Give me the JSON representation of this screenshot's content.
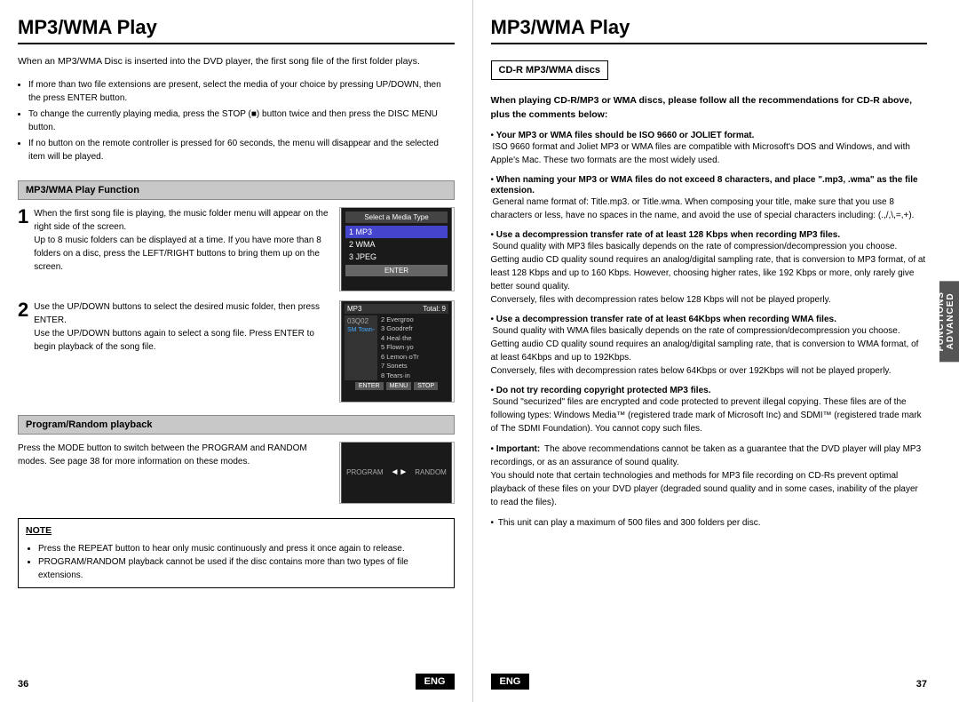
{
  "left": {
    "title": "MP3/WMA Play",
    "intro": "When an MP3/WMA Disc is inserted into the DVD player, the first song file of the first folder plays.",
    "bullets": [
      "If more than two file extensions are present, select the media of your choice by pressing UP/DOWN, then the press ENTER button.",
      "To change the currently playing media, press the STOP (■) button twice and then press the DISC MENU button.",
      "If no button on the remote controller is pressed for 60 seconds, the menu will disappear and the selected item will be played."
    ],
    "section1_header": "MP3/WMA Play Function",
    "step1_number": "1",
    "step1_text": "When the first song file is playing, the music folder menu will appear on the right side of the screen.\nUp to 8 music folders can be displayed at a time. If you have more than 8 folders on a disc, press the LEFT/RIGHT buttons to bring them up on the screen.",
    "step2_number": "2",
    "step2_text": "Use the UP/DOWN buttons to select the desired music folder, then press ENTER.\nUse the UP/DOWN buttons again to select a song file. Press ENTER to begin playback of the song file.",
    "section2_header": "Program/Random playback",
    "section2_text": "Press the MODE button to switch between the PROGRAM and RANDOM modes. See page 38 for more information on these modes.",
    "note_header": "NOTE",
    "note_bullets": [
      "Press the REPEAT button to hear only music continuously and press it once again to release.",
      "PROGRAM/RANDOM playback cannot be used if the disc contains more than two types of file extensions."
    ],
    "page_number": "36",
    "eng_label": "ENG",
    "media_selector": {
      "title": "Select a Media Type",
      "items": [
        "1 MP3",
        "2 WMA",
        "3 JPEG"
      ],
      "selected": 0,
      "enter": "ENTER"
    },
    "folder_list": {
      "label": "MP3",
      "total": "Total: 9",
      "folder": "03Q02",
      "items": [
        "2 Evergroo",
        "3 Goodrefr",
        "4 Heal-the",
        "5 Flown-yo",
        "6 Lemon-oTr",
        "7 Sonets",
        "8 Tears-in"
      ],
      "selected_folder": "SM Town-"
    },
    "program_random": {
      "program": "PROGRAM",
      "arrow": "◄►",
      "random": "RANDOM"
    }
  },
  "right": {
    "title": "MP3/WMA Play",
    "cdr_header": "CD-R MP3/WMA discs",
    "bold_intro": "When playing CD-R/MP3 or WMA discs, please follow all the recommendations for CD-R above, plus the comments below:",
    "bullets": [
      {
        "title": "Your MP3 or WMA files should be ISO 9660 or JOLIET format.",
        "text": "ISO 9660 format and Joliet MP3 or WMA files are compatible with Microsoft's DOS and Windows, and with Apple's Mac. These two formats are the most widely used."
      },
      {
        "title": "When naming your MP3 or WMA files do not exceed 8 characters, and place \".mp3, .wma\" as the file extension.",
        "text": "General name format of: Title.mp3. or Title.wma. When composing your title, make sure that you use 8 characters or less, have no spaces in the name, and avoid the use of special characters including: (.,/,\\,=,+)."
      },
      {
        "title": "Use a decompression transfer rate of at least 128 Kbps when recording MP3 files.",
        "text": "Sound quality with MP3 files basically depends on the rate of compression/decompression you choose. Getting audio CD quality sound requires an analog/digital sampling rate, that is conversion to MP3 format, of at least 128 Kbps and up to 160 Kbps. However, choosing higher rates, like 192 Kbps or more, only rarely give better sound quality.\nConversely, files with decompression rates below 128 Kbps will not be played properly."
      },
      {
        "title": "Use a decompression transfer rate of at least 64Kbps when recording WMA files.",
        "text": "Sound quality with WMA files basically depends on the rate of compression/decompression you choose. Getting audio CD quality sound requires an analog/digital sampling rate, that is conversion to WMA format, of at least 64Kbps and up to 192Kbps.\nConversely, files with decompression rates below 64Kbps or over 192Kbps will not be played properly."
      },
      {
        "title": "Do not try recording copyright protected MP3 files.",
        "text": "Sound \"securized\" files are encrypted and code protected to prevent illegal copying. These files are of the following types: Windows Media™ (registered trade mark of Microsoft Inc) and SDMI™ (registered trade mark of The SDMI Foundation). You cannot copy such files."
      },
      {
        "title": "Important:",
        "text": "The above recommendations cannot be taken as a guarantee that the DVD player will play MP3 recordings, or as an assurance of sound quality.\nYou should note that certain technologies and methods for MP3 file recording on CD-Rs prevent optimal playback of these files on your DVD player (degraded sound quality and in some cases, inability of the player to read the files)."
      },
      {
        "title": "",
        "text": "This unit can play a maximum of 500 files and 300 folders per disc."
      }
    ],
    "advanced_functions": "ADVANCED\nFUNCTIONS",
    "page_number": "37",
    "eng_label": "ENG"
  }
}
